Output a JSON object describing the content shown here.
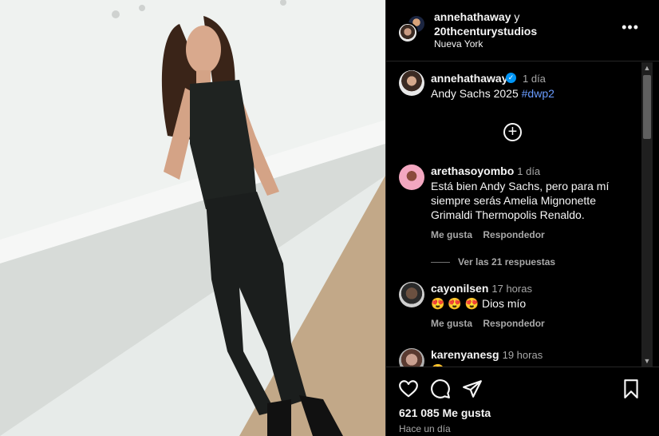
{
  "header": {
    "user1": "annehathaway",
    "joiner": "y",
    "user2": "20thcenturystudios",
    "location": "Nueva York",
    "more_label": "•••"
  },
  "caption": {
    "username": "annehathaway",
    "time": "1 día",
    "text": "Andy Sachs 2025",
    "hashtag": "#dwp2"
  },
  "comments": [
    {
      "username": "arethasoyombo",
      "time": "1 día",
      "text": "Está bien Andy Sachs, pero para mí siempre serás Amelia Mignonette Grimaldi Thermopolis Renaldo.",
      "like_label": "Me gusta",
      "reply_label": "Respondedor"
    },
    {
      "username": "cayonilsen",
      "time": "17 horas",
      "text": "😍 😍 😍 Dios mío",
      "like_label": "Me gusta",
      "reply_label": "Respondedor"
    },
    {
      "username": "karenyanesg",
      "time": "19 horas",
      "text": "😍"
    }
  ],
  "view_replies": "Ver las 21 respuestas",
  "footer": {
    "likes": "621 085 Me gusta",
    "time_ago": "Hace un día"
  },
  "icons": [
    "heart-icon",
    "comment-icon",
    "share-icon",
    "bookmark-icon",
    "add-comment-icon",
    "verified-badge-icon"
  ],
  "colors": {
    "verified": "#0095f6",
    "hashtag": "#6a9cff",
    "secondary": "#a8a8a8"
  }
}
